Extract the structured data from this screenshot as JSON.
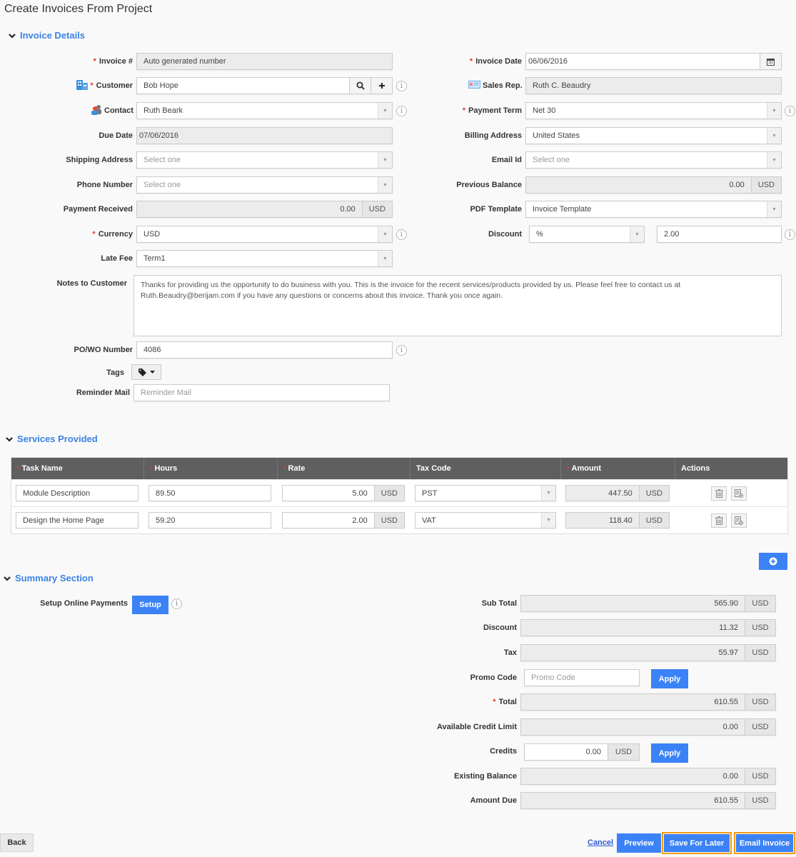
{
  "page": {
    "title": "Create Invoices From Project"
  },
  "sections": {
    "invoice_details": "Invoice Details",
    "services_provided": "Services Provided",
    "summary": "Summary Section"
  },
  "invoice": {
    "invoice_no": {
      "label": "Invoice #",
      "value": "Auto generated number"
    },
    "customer": {
      "label": "Customer",
      "value": "Bob Hope"
    },
    "contact": {
      "label": "Contact",
      "value": "Ruth Beark"
    },
    "due_date": {
      "label": "Due Date",
      "value": "07/06/2016"
    },
    "shipping_address": {
      "label": "Shipping Address",
      "placeholder": "Select one"
    },
    "phone_number": {
      "label": "Phone Number",
      "placeholder": "Select one"
    },
    "payment_received": {
      "label": "Payment Received",
      "value": "0.00",
      "currency": "USD"
    },
    "currency": {
      "label": "Currency",
      "value": "USD"
    },
    "late_fee": {
      "label": "Late Fee",
      "value": "Term1"
    },
    "invoice_date": {
      "label": "Invoice Date",
      "value": "06/06/2016"
    },
    "sales_rep": {
      "label": "Sales Rep.",
      "value": "Ruth C. Beaudry"
    },
    "payment_term": {
      "label": "Payment Term",
      "value": "Net 30"
    },
    "billing_address": {
      "label": "Billing Address",
      "value": "United States"
    },
    "email_id": {
      "label": "Email Id",
      "placeholder": "Select one"
    },
    "previous_balance": {
      "label": "Previous Balance",
      "value": "0.00",
      "currency": "USD"
    },
    "pdf_template": {
      "label": "PDF Template",
      "value": "Invoice Template"
    },
    "discount": {
      "label": "Discount",
      "type": "%",
      "value": "2.00"
    },
    "notes": {
      "label": "Notes to Customer",
      "value": "Thanks for providing us the opportunity to do business with you. This is the invoice for the recent services/products provided by us. Please feel free to contact us at Ruth.Beaudry@berijam.com if you have any questions or concerns about this invoice. Thank you once again."
    },
    "po_number": {
      "label": "PO/WO Number",
      "value": "4086"
    },
    "tags": {
      "label": "Tags"
    },
    "reminder_mail": {
      "label": "Reminder Mail",
      "placeholder": "Reminder Mail"
    }
  },
  "services": {
    "columns": [
      "Task Name",
      "Hours",
      "Rate",
      "Tax Code",
      "Amount",
      "Actions"
    ],
    "rows": [
      {
        "task": "Module Description",
        "hours": "89.50",
        "rate": "5.00",
        "rate_currency": "USD",
        "tax_code": "PST",
        "amount": "447.50",
        "amount_currency": "USD"
      },
      {
        "task": "Design the Home Page",
        "hours": "59.20",
        "rate": "2.00",
        "rate_currency": "USD",
        "tax_code": "VAT",
        "amount": "118.40",
        "amount_currency": "USD"
      }
    ]
  },
  "summary": {
    "setup_online_payments": {
      "label": "Setup Online Payments",
      "button": "Setup"
    },
    "sub_total": {
      "label": "Sub Total",
      "value": "565.90",
      "currency": "USD"
    },
    "discount": {
      "label": "Discount",
      "value": "11.32",
      "currency": "USD"
    },
    "tax": {
      "label": "Tax",
      "value": "55.97",
      "currency": "USD"
    },
    "promo_code": {
      "label": "Promo Code",
      "placeholder": "Promo Code",
      "button": "Apply"
    },
    "total": {
      "label": "Total",
      "value": "610.55",
      "currency": "USD"
    },
    "available_credit_limit": {
      "label": "Available Credit Limit",
      "value": "0.00",
      "currency": "USD"
    },
    "credits": {
      "label": "Credits",
      "value": "0.00",
      "currency": "USD",
      "button": "Apply"
    },
    "existing_balance": {
      "label": "Existing Balance",
      "value": "0.00",
      "currency": "USD"
    },
    "amount_due": {
      "label": "Amount Due",
      "value": "610.55",
      "currency": "USD"
    }
  },
  "footer": {
    "back": "Back",
    "cancel": "Cancel",
    "preview": "Preview",
    "save_for_later": "Save For Later",
    "email_invoice": "Email Invoice"
  },
  "colors": {
    "accent": "#3b82f6",
    "highlight": "#f39c12",
    "required": "#e53935",
    "table_header": "#5f5f5f"
  }
}
